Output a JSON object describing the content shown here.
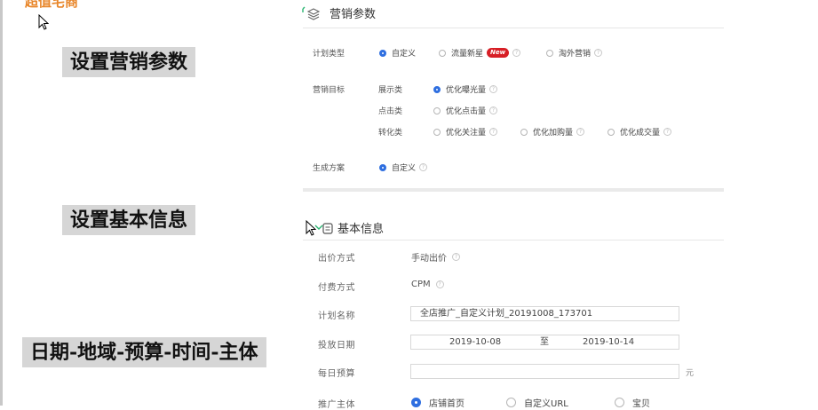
{
  "brand": "超值宅商",
  "labels": {
    "marketing": "设置营销参数",
    "basic": "设置基本信息",
    "schedule": "日期-地域-预算-时间-主体"
  },
  "marketing_panel": {
    "title": "营销参数",
    "plan_type": {
      "label": "计划类型",
      "options": [
        {
          "label": "自定义",
          "selected": true
        },
        {
          "label": "流量新星",
          "badge": "New",
          "selected": false
        },
        {
          "label": "淘外营销",
          "selected": false
        }
      ]
    },
    "goal": {
      "label": "营销目标",
      "groups": [
        {
          "label": "展示类",
          "options": [
            "优化曝光量"
          ]
        },
        {
          "label": "点击类",
          "options": [
            "优化点击量"
          ]
        },
        {
          "label": "转化类",
          "options": [
            "优化关注量",
            "优化加购量",
            "优化成交量"
          ]
        }
      ]
    },
    "plan_gen": {
      "label": "生成方案",
      "options": [
        {
          "label": "自定义",
          "selected": true
        }
      ]
    }
  },
  "basic_panel": {
    "title": "基本信息",
    "bid_mode": {
      "label": "出价方式",
      "value": "手动出价"
    },
    "pay_mode": {
      "label": "付费方式",
      "value": "CPM"
    },
    "plan_name": {
      "label": "计划名称",
      "value": "全店推广_自定义计划_20191008_173701"
    },
    "date": {
      "label": "投放日期",
      "start": "2019-10-08",
      "sep": "至",
      "end": "2019-10-14"
    },
    "budget": {
      "label": "每日预算",
      "value": "",
      "unit": "元"
    },
    "subject": {
      "label": "推广主体",
      "options": [
        {
          "label": "店铺首页",
          "selected": true
        },
        {
          "label": "自定义URL",
          "selected": false
        },
        {
          "label": "宝贝",
          "selected": false
        }
      ]
    }
  },
  "icons": {
    "help": "?"
  }
}
